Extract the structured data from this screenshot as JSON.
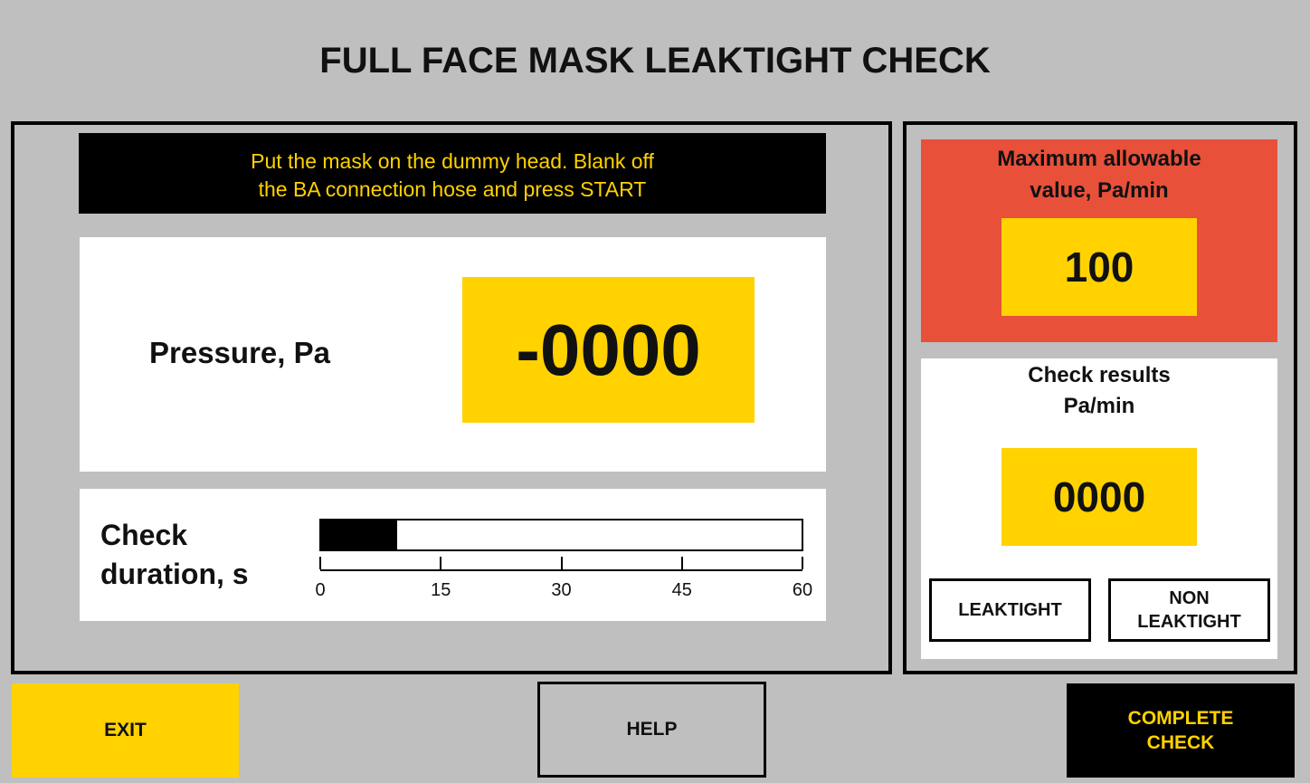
{
  "title": "FULL FACE MASK LEAKTIGHT CHECK",
  "instruction": {
    "line1": "Put the mask on the dummy head. Blank off",
    "line2": "the BA connection hose and press START"
  },
  "pressure": {
    "label": "Pressure, Pa",
    "value": "-0000"
  },
  "duration": {
    "label_line1": "Check",
    "label_line2": "duration, s",
    "progress_seconds": 9.5,
    "scale_max": 60,
    "ticks": [
      "0",
      "15",
      "30",
      "45",
      "60"
    ]
  },
  "max_allowable": {
    "label_line1": "Maximum allowable",
    "label_line2": "value, Pa/min",
    "value": "100"
  },
  "results": {
    "label_line1": "Check results",
    "label_line2": "Pa/min",
    "value": "0000"
  },
  "buttons": {
    "leaktight": "LEAKTIGHT",
    "non_leaktight_line1": "NON",
    "non_leaktight_line2": "LEAKTIGHT",
    "exit": "EXIT",
    "help": "HELP",
    "complete_line1": "COMPLETE",
    "complete_line2": "CHECK"
  },
  "colors": {
    "background": "#bfbfbf",
    "accent_yellow": "#ffd200",
    "alert_red": "#e8503a"
  }
}
